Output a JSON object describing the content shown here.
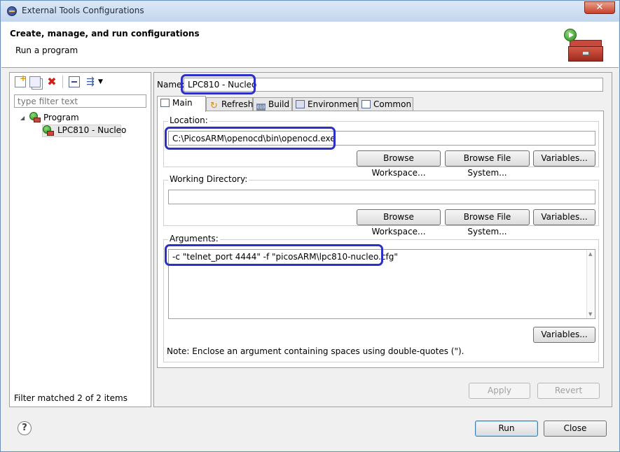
{
  "window": {
    "title": "External Tools Configurations",
    "close_glyph": "✕"
  },
  "header": {
    "title": "Create, manage, and run configurations",
    "subtitle": "Run a program"
  },
  "left": {
    "filter_placeholder": "type filter text",
    "tree": {
      "category": "Program",
      "item": "LPC810 - Nucleo"
    },
    "status": "Filter matched 2 of 2 items"
  },
  "right": {
    "name_label": "Name:",
    "name_value": "LPC810 - Nucleo",
    "tabs": [
      "Main",
      "Refresh",
      "Build",
      "Environment",
      "Common"
    ],
    "location": {
      "label": "Location:",
      "value": "C:\\PicosARM\\openocd\\bin\\openocd.exe"
    },
    "working_dir": {
      "label": "Working Directory:",
      "value": ""
    },
    "arguments": {
      "label": "Arguments:",
      "value": "-c \"telnet_port 4444\" -f \"picosARM\\lpc810-nucleo.cfg\""
    },
    "buttons": {
      "browse_workspace": "Browse Workspace...",
      "browse_file_system": "Browse File System...",
      "variables": "Variables..."
    },
    "note": "Note: Enclose an argument containing spaces using double-quotes (\").",
    "apply": "Apply",
    "revert": "Revert"
  },
  "footer": {
    "help": "?",
    "run": "Run",
    "close": "Close"
  },
  "icons": {
    "left_toolbar": [
      "new-configuration-icon",
      "duplicate-icon",
      "delete-icon",
      "collapse-all-icon",
      "filter-icon",
      "dropdown-arrow-icon"
    ]
  },
  "colors": {
    "highlight": "#2a30c8"
  }
}
